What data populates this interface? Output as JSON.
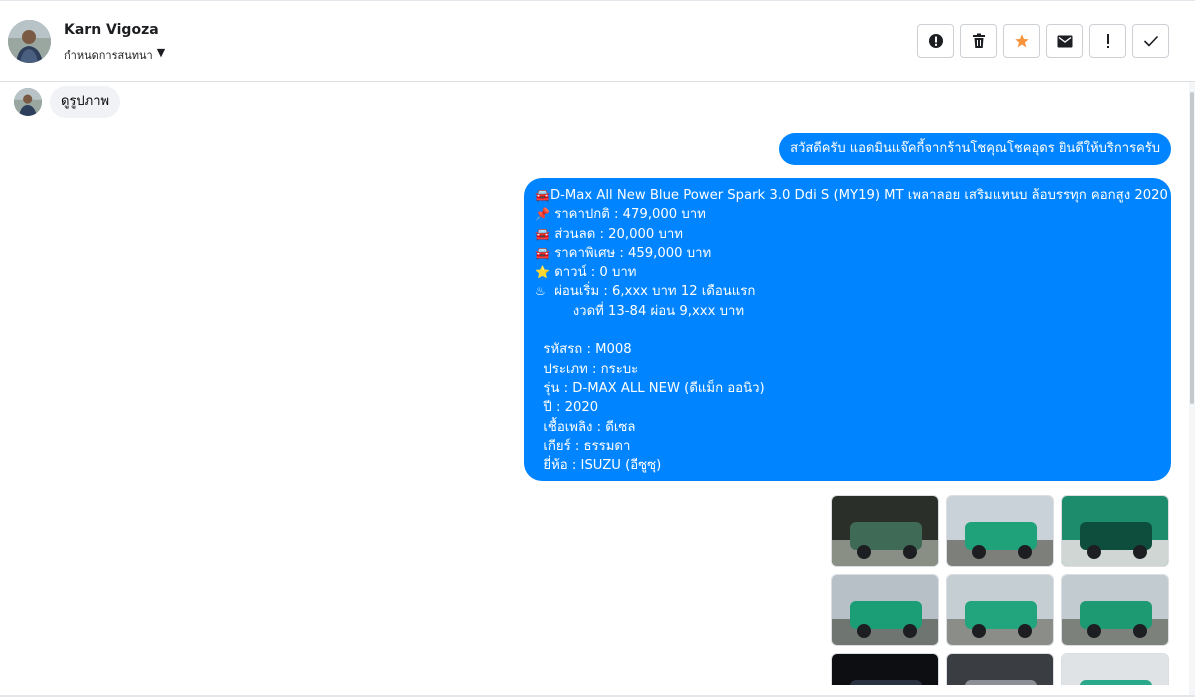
{
  "contact": {
    "name": "Karn Vigoza",
    "sub_label": "กำหนดการสนทนา"
  },
  "actions": [
    {
      "name": "alert-circle-icon",
      "label": "spam"
    },
    {
      "name": "trash-icon",
      "label": "delete"
    },
    {
      "name": "star-icon",
      "label": "star"
    },
    {
      "name": "mail-icon",
      "label": "unread"
    },
    {
      "name": "exclamation-icon",
      "label": "important"
    },
    {
      "name": "check-icon",
      "label": "done"
    }
  ],
  "colors": {
    "accent": "#0084ff",
    "star": "#f7923a",
    "incoming_bg": "#f0f2f5"
  },
  "messages": {
    "incoming_1": "ดูรูปภาพ",
    "outgoing_1": "สวัสดีครับ แอดมินแจ๊คกี้จากร้านโชคุณโชคอุดร ยินดีให้บริการครับ",
    "outgoing_2": {
      "lines": [
        {
          "icon": "🚘",
          "text": "D-Max All New Blue Power Spark 3.0 Ddi S (MY19) MT เพลาลอย เสริมแหนบ ล้อบรรทุก คอกสูง 2020"
        },
        {
          "icon": "📌",
          "text": " ราคาปกติ : 479,000 บาท"
        },
        {
          "icon": "🚘",
          "text": " ส่วนลด : 20,000 บาท"
        },
        {
          "icon": "🚘",
          "text": " ราคาพิเศษ : 459,000 บาท"
        },
        {
          "icon": "⭐",
          "text": " ดาวน์ : 0 บาท"
        },
        {
          "icon": "♨",
          "text": " ผ่อนเริ่ม : 6,xxx บาท 12 เดือนแรก"
        },
        {
          "icon": "",
          "text": "         งวดที่ 13-84 ผ่อน 9,xxx บาท"
        },
        {
          "icon": "",
          "text": ""
        },
        {
          "icon": "",
          "text": "  รหัสรถ : M008"
        },
        {
          "icon": "",
          "text": "  ประเภท : กระบะ"
        },
        {
          "icon": "",
          "text": "  รุ่น : D-MAX ALL NEW (ดีแม็ก ออนิว)"
        },
        {
          "icon": "",
          "text": "  ปี : 2020"
        },
        {
          "icon": "",
          "text": "  เชื้อเพลิง : ดีเซล"
        },
        {
          "icon": "",
          "text": "  เกียร์ : ธรรมดา"
        },
        {
          "icon": "",
          "text": "  ยี่ห้อ : ISUZU (อีซูซุ)"
        }
      ]
    }
  },
  "gallery": {
    "photos": [
      {
        "name": "photo-engine-bay"
      },
      {
        "name": "photo-truck-front-left"
      },
      {
        "name": "photo-headlight-closeup"
      },
      {
        "name": "photo-truck-front"
      },
      {
        "name": "photo-truck-side"
      },
      {
        "name": "photo-truck-rear"
      },
      {
        "name": "photo-dashboard"
      },
      {
        "name": "photo-console"
      },
      {
        "name": "photo-interior"
      }
    ]
  }
}
